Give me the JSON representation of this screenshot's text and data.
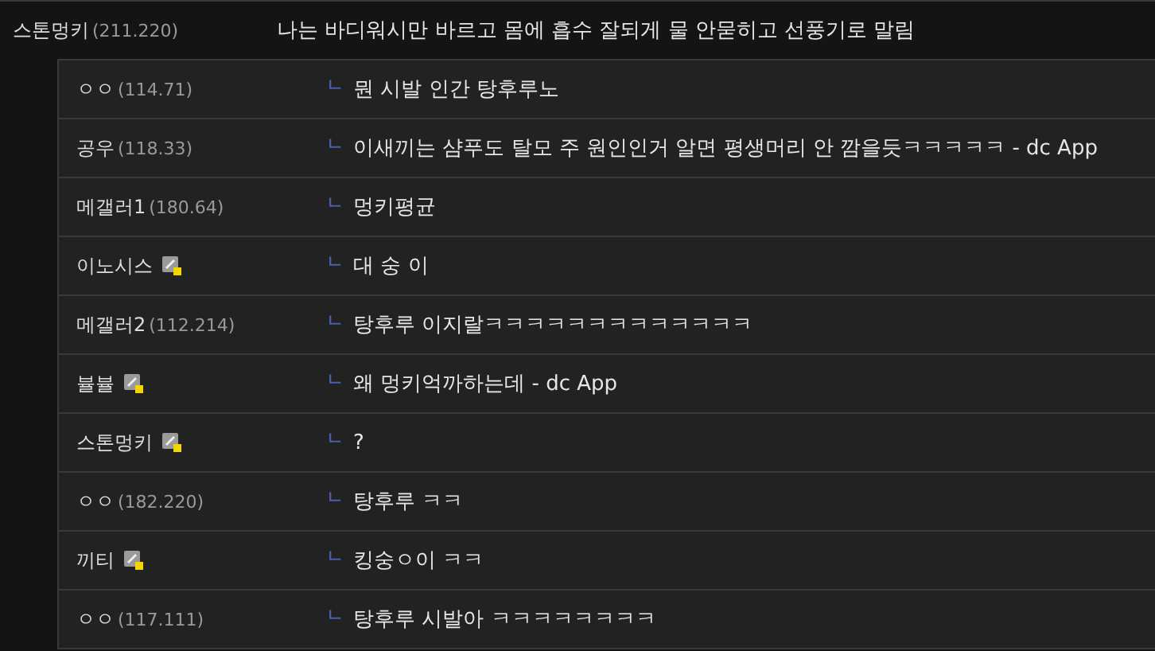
{
  "comment": {
    "name": "스톤멍키",
    "ip": "(211.220)",
    "text": "나는 바디워시만 바르고 몸에 흡수 잘되게 물 안묻히고 선풍기로 말림"
  },
  "replies": [
    {
      "name": "ㅇㅇ",
      "ip": "(114.71)",
      "member": false,
      "marker": "ㄴ",
      "text": "뭔 시발 인간 탕후루노"
    },
    {
      "name": "공우",
      "ip": "(118.33)",
      "member": false,
      "marker": "ㄴ",
      "text": "이새끼는 샴푸도 탈모 주 원인인거 알면 평생머리 안 깜을듯ㅋㅋㅋㅋㅋ - dc App"
    },
    {
      "name": "메갤러1",
      "ip": "(180.64)",
      "member": false,
      "marker": "ㄴ",
      "text": "멍키평균"
    },
    {
      "name": "이노시스",
      "member": true,
      "marker": "ㄴ",
      "text": "대 숭 이"
    },
    {
      "name": "메갤러2",
      "ip": "(112.214)",
      "member": false,
      "marker": "ㄴ",
      "text": "탕후루 이지랄ㅋㅋㅋㅋㅋㅋㅋㅋㅋㅋㅋㅋㅋ"
    },
    {
      "name": "뷸뷸",
      "member": true,
      "marker": "ㄴ",
      "text": "왜 멍키억까하는데 - dc App"
    },
    {
      "name": "스톤멍키",
      "member": true,
      "marker": "ㄴ",
      "text": "?"
    },
    {
      "name": "ㅇㅇ",
      "ip": "(182.220)",
      "member": false,
      "marker": "ㄴ",
      "text": "탕후루 ㅋㅋ"
    },
    {
      "name": "끼티",
      "member": true,
      "marker": "ㄴ",
      "text": "킹숭ㅇ이 ㅋㅋ"
    },
    {
      "name": "ㅇㅇ",
      "ip": "(117.111)",
      "member": false,
      "marker": "ㄴ",
      "text": "탕후루 시발아 ㅋㅋㅋㅋㅋㅋㅋㅋ"
    }
  ]
}
